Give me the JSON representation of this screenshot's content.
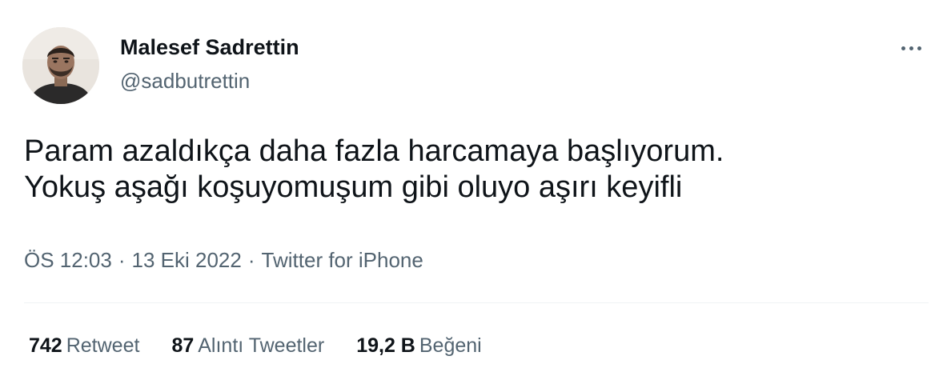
{
  "user": {
    "display_name": "Malesef Sadrettin",
    "handle": "@sadbutrettin",
    "avatar_icon": "profile-photo"
  },
  "tweet": {
    "lines": [
      "Param azaldıkça daha fazla harcamaya başlıyorum.",
      "Yokuş aşağı koşuyomuşum gibi oluyo aşırı keyifli"
    ],
    "time": "ÖS 12:03",
    "date": "13 Eki 2022",
    "separator": "·",
    "source": "Twitter for iPhone"
  },
  "stats": {
    "retweets": {
      "count": "742",
      "label": "Retweet"
    },
    "quotes": {
      "count": "87",
      "label": "Alıntı Tweetler"
    },
    "likes": {
      "count": "19,2 B",
      "label": "Beğeni"
    }
  },
  "icons": {
    "more": "more-horizontal-icon"
  },
  "colors": {
    "text_primary": "#0f1419",
    "text_secondary": "#536471",
    "divider": "#eff3f4",
    "background": "#ffffff"
  }
}
